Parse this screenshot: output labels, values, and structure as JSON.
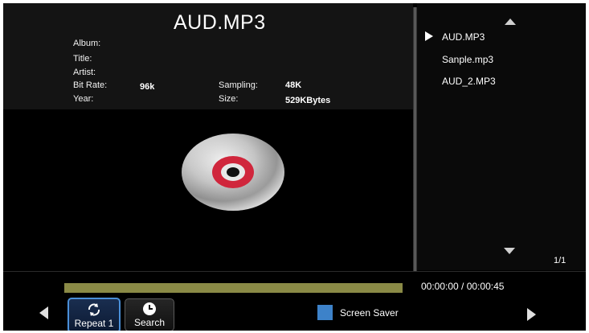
{
  "file": {
    "title": "AUD.MP3"
  },
  "info": {
    "album_label": "Album:",
    "title_label": "Title:",
    "artist_label": "Artist:",
    "bitrate_label": "Bit Rate:",
    "bitrate_value": "96k",
    "year_label": "Year:",
    "sampling_label": "Sampling:",
    "sampling_value": "48K",
    "size_label": "Size:",
    "size_value": "529KBytes"
  },
  "playlist": {
    "items": [
      {
        "label": "AUD.MP3",
        "playing": true
      },
      {
        "label": "Sanple.mp3",
        "playing": false
      },
      {
        "label": "AUD_2.MP3",
        "playing": false
      }
    ],
    "page": "1/1"
  },
  "playback": {
    "time": "00:00:00 / 00:00:45",
    "progress_fraction": 1.0
  },
  "controls": {
    "repeat_label": "Repeat 1",
    "search_label": "Search",
    "screen_saver_label": "Screen Saver"
  },
  "colors": {
    "progress_fill": "#8a8a46",
    "accent": "#4a8fd8",
    "screen_saver_box": "#3d82c9",
    "disc_center": "#d0263c"
  }
}
